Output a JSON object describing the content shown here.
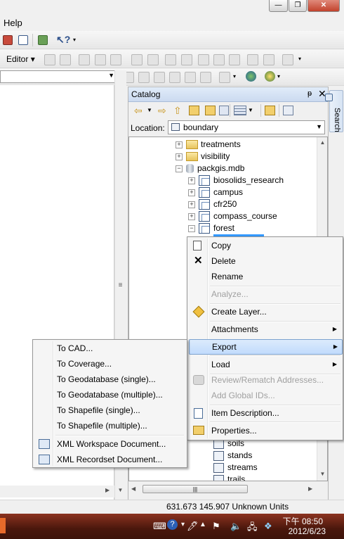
{
  "menubar": {
    "help": "Help"
  },
  "editor_toolbar": {
    "editor_label": "Editor"
  },
  "catalog": {
    "title": "Catalog",
    "pin": "ᵽ",
    "close": "✕",
    "location_label": "Location:",
    "location_value": "boundary",
    "tree": [
      {
        "label": "treatments",
        "type": "folder",
        "expander": "+",
        "indent": 1
      },
      {
        "label": "visibility",
        "type": "folder",
        "expander": "+",
        "indent": 1
      },
      {
        "label": "packgis.mdb",
        "type": "database",
        "expander": "−",
        "indent": 1
      },
      {
        "label": "biosolids_research",
        "type": "dataset",
        "expander": "+",
        "indent": 2
      },
      {
        "label": "campus",
        "type": "dataset",
        "expander": "+",
        "indent": 2
      },
      {
        "label": "cfr250",
        "type": "dataset",
        "expander": "+",
        "indent": 2
      },
      {
        "label": "compass_course",
        "type": "dataset",
        "expander": "+",
        "indent": 2
      },
      {
        "label": "forest",
        "type": "dataset",
        "expander": "−",
        "indent": 2
      }
    ],
    "tree_lower": [
      {
        "label": "soils",
        "type": "featureclass"
      },
      {
        "label": "stands",
        "type": "featureclass"
      },
      {
        "label": "streams",
        "type": "featureclass"
      },
      {
        "label": "trails",
        "type": "featureclass"
      }
    ]
  },
  "search_tab": "Search",
  "context_menu": {
    "items": [
      {
        "label": "Copy",
        "icon": "copy-icon",
        "enabled": true
      },
      {
        "label": "Delete",
        "icon": "delete-icon",
        "enabled": true
      },
      {
        "label": "Rename",
        "icon": "",
        "enabled": true
      },
      {
        "label": "Analyze...",
        "icon": "",
        "enabled": false
      },
      {
        "label": "Create Layer...",
        "icon": "layer-icon",
        "enabled": true
      },
      {
        "label": "Attachments",
        "icon": "",
        "enabled": true,
        "submenu": true
      },
      {
        "label": "Export",
        "icon": "",
        "enabled": true,
        "submenu": true,
        "highlighted": true
      },
      {
        "label": "Load",
        "icon": "",
        "enabled": true,
        "submenu": true
      },
      {
        "label": "Review/Rematch Addresses...",
        "icon": "geocode-icon",
        "enabled": false
      },
      {
        "label": "Add Global IDs...",
        "icon": "",
        "enabled": false
      },
      {
        "label": "Item Description...",
        "icon": "description-icon",
        "enabled": true
      },
      {
        "label": "Properties...",
        "icon": "properties-icon",
        "enabled": true
      }
    ]
  },
  "export_submenu": {
    "items": [
      {
        "label": "To CAD...",
        "icon": ""
      },
      {
        "label": "To Coverage...",
        "icon": ""
      },
      {
        "label": "To Geodatabase (single)...",
        "icon": ""
      },
      {
        "label": "To Geodatabase (multiple)...",
        "icon": ""
      },
      {
        "label": "To Shapefile (single)...",
        "icon": ""
      },
      {
        "label": "To Shapefile (multiple)...",
        "icon": ""
      },
      {
        "label": "XML Workspace Document...",
        "icon": "xml-workspace-icon"
      },
      {
        "label": "XML Recordset Document...",
        "icon": "xml-recordset-icon"
      }
    ]
  },
  "statusbar": {
    "coords": "631.673  145.907 Unknown Units"
  },
  "taskbar": {
    "time": "下午 08:50",
    "date": "2012/6/23"
  }
}
